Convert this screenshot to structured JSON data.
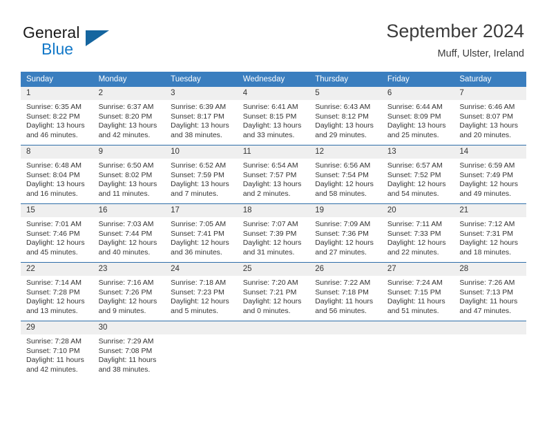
{
  "brand": {
    "name_part1": "General",
    "name_part2": "Blue",
    "accent_color": "#1278c8",
    "triangle_color": "#15659f"
  },
  "header": {
    "title": "September 2024",
    "location": "Muff, Ulster, Ireland"
  },
  "calendar": {
    "header_bg": "#3a7ebf",
    "header_text_color": "#ffffff",
    "daynum_bg": "#efefef",
    "row_divider_color": "#2c6ca8",
    "weekdays": [
      "Sunday",
      "Monday",
      "Tuesday",
      "Wednesday",
      "Thursday",
      "Friday",
      "Saturday"
    ],
    "weeks": [
      [
        {
          "day": "1",
          "sunrise": "Sunrise: 6:35 AM",
          "sunset": "Sunset: 8:22 PM",
          "daylight_line1": "Daylight: 13 hours",
          "daylight_line2": "and 46 minutes."
        },
        {
          "day": "2",
          "sunrise": "Sunrise: 6:37 AM",
          "sunset": "Sunset: 8:20 PM",
          "daylight_line1": "Daylight: 13 hours",
          "daylight_line2": "and 42 minutes."
        },
        {
          "day": "3",
          "sunrise": "Sunrise: 6:39 AM",
          "sunset": "Sunset: 8:17 PM",
          "daylight_line1": "Daylight: 13 hours",
          "daylight_line2": "and 38 minutes."
        },
        {
          "day": "4",
          "sunrise": "Sunrise: 6:41 AM",
          "sunset": "Sunset: 8:15 PM",
          "daylight_line1": "Daylight: 13 hours",
          "daylight_line2": "and 33 minutes."
        },
        {
          "day": "5",
          "sunrise": "Sunrise: 6:43 AM",
          "sunset": "Sunset: 8:12 PM",
          "daylight_line1": "Daylight: 13 hours",
          "daylight_line2": "and 29 minutes."
        },
        {
          "day": "6",
          "sunrise": "Sunrise: 6:44 AM",
          "sunset": "Sunset: 8:09 PM",
          "daylight_line1": "Daylight: 13 hours",
          "daylight_line2": "and 25 minutes."
        },
        {
          "day": "7",
          "sunrise": "Sunrise: 6:46 AM",
          "sunset": "Sunset: 8:07 PM",
          "daylight_line1": "Daylight: 13 hours",
          "daylight_line2": "and 20 minutes."
        }
      ],
      [
        {
          "day": "8",
          "sunrise": "Sunrise: 6:48 AM",
          "sunset": "Sunset: 8:04 PM",
          "daylight_line1": "Daylight: 13 hours",
          "daylight_line2": "and 16 minutes."
        },
        {
          "day": "9",
          "sunrise": "Sunrise: 6:50 AM",
          "sunset": "Sunset: 8:02 PM",
          "daylight_line1": "Daylight: 13 hours",
          "daylight_line2": "and 11 minutes."
        },
        {
          "day": "10",
          "sunrise": "Sunrise: 6:52 AM",
          "sunset": "Sunset: 7:59 PM",
          "daylight_line1": "Daylight: 13 hours",
          "daylight_line2": "and 7 minutes."
        },
        {
          "day": "11",
          "sunrise": "Sunrise: 6:54 AM",
          "sunset": "Sunset: 7:57 PM",
          "daylight_line1": "Daylight: 13 hours",
          "daylight_line2": "and 2 minutes."
        },
        {
          "day": "12",
          "sunrise": "Sunrise: 6:56 AM",
          "sunset": "Sunset: 7:54 PM",
          "daylight_line1": "Daylight: 12 hours",
          "daylight_line2": "and 58 minutes."
        },
        {
          "day": "13",
          "sunrise": "Sunrise: 6:57 AM",
          "sunset": "Sunset: 7:52 PM",
          "daylight_line1": "Daylight: 12 hours",
          "daylight_line2": "and 54 minutes."
        },
        {
          "day": "14",
          "sunrise": "Sunrise: 6:59 AM",
          "sunset": "Sunset: 7:49 PM",
          "daylight_line1": "Daylight: 12 hours",
          "daylight_line2": "and 49 minutes."
        }
      ],
      [
        {
          "day": "15",
          "sunrise": "Sunrise: 7:01 AM",
          "sunset": "Sunset: 7:46 PM",
          "daylight_line1": "Daylight: 12 hours",
          "daylight_line2": "and 45 minutes."
        },
        {
          "day": "16",
          "sunrise": "Sunrise: 7:03 AM",
          "sunset": "Sunset: 7:44 PM",
          "daylight_line1": "Daylight: 12 hours",
          "daylight_line2": "and 40 minutes."
        },
        {
          "day": "17",
          "sunrise": "Sunrise: 7:05 AM",
          "sunset": "Sunset: 7:41 PM",
          "daylight_line1": "Daylight: 12 hours",
          "daylight_line2": "and 36 minutes."
        },
        {
          "day": "18",
          "sunrise": "Sunrise: 7:07 AM",
          "sunset": "Sunset: 7:39 PM",
          "daylight_line1": "Daylight: 12 hours",
          "daylight_line2": "and 31 minutes."
        },
        {
          "day": "19",
          "sunrise": "Sunrise: 7:09 AM",
          "sunset": "Sunset: 7:36 PM",
          "daylight_line1": "Daylight: 12 hours",
          "daylight_line2": "and 27 minutes."
        },
        {
          "day": "20",
          "sunrise": "Sunrise: 7:11 AM",
          "sunset": "Sunset: 7:33 PM",
          "daylight_line1": "Daylight: 12 hours",
          "daylight_line2": "and 22 minutes."
        },
        {
          "day": "21",
          "sunrise": "Sunrise: 7:12 AM",
          "sunset": "Sunset: 7:31 PM",
          "daylight_line1": "Daylight: 12 hours",
          "daylight_line2": "and 18 minutes."
        }
      ],
      [
        {
          "day": "22",
          "sunrise": "Sunrise: 7:14 AM",
          "sunset": "Sunset: 7:28 PM",
          "daylight_line1": "Daylight: 12 hours",
          "daylight_line2": "and 13 minutes."
        },
        {
          "day": "23",
          "sunrise": "Sunrise: 7:16 AM",
          "sunset": "Sunset: 7:26 PM",
          "daylight_line1": "Daylight: 12 hours",
          "daylight_line2": "and 9 minutes."
        },
        {
          "day": "24",
          "sunrise": "Sunrise: 7:18 AM",
          "sunset": "Sunset: 7:23 PM",
          "daylight_line1": "Daylight: 12 hours",
          "daylight_line2": "and 5 minutes."
        },
        {
          "day": "25",
          "sunrise": "Sunrise: 7:20 AM",
          "sunset": "Sunset: 7:21 PM",
          "daylight_line1": "Daylight: 12 hours",
          "daylight_line2": "and 0 minutes."
        },
        {
          "day": "26",
          "sunrise": "Sunrise: 7:22 AM",
          "sunset": "Sunset: 7:18 PM",
          "daylight_line1": "Daylight: 11 hours",
          "daylight_line2": "and 56 minutes."
        },
        {
          "day": "27",
          "sunrise": "Sunrise: 7:24 AM",
          "sunset": "Sunset: 7:15 PM",
          "daylight_line1": "Daylight: 11 hours",
          "daylight_line2": "and 51 minutes."
        },
        {
          "day": "28",
          "sunrise": "Sunrise: 7:26 AM",
          "sunset": "Sunset: 7:13 PM",
          "daylight_line1": "Daylight: 11 hours",
          "daylight_line2": "and 47 minutes."
        }
      ],
      [
        {
          "day": "29",
          "sunrise": "Sunrise: 7:28 AM",
          "sunset": "Sunset: 7:10 PM",
          "daylight_line1": "Daylight: 11 hours",
          "daylight_line2": "and 42 minutes."
        },
        {
          "day": "30",
          "sunrise": "Sunrise: 7:29 AM",
          "sunset": "Sunset: 7:08 PM",
          "daylight_line1": "Daylight: 11 hours",
          "daylight_line2": "and 38 minutes."
        },
        {
          "day": "",
          "sunrise": "",
          "sunset": "",
          "daylight_line1": "",
          "daylight_line2": ""
        },
        {
          "day": "",
          "sunrise": "",
          "sunset": "",
          "daylight_line1": "",
          "daylight_line2": ""
        },
        {
          "day": "",
          "sunrise": "",
          "sunset": "",
          "daylight_line1": "",
          "daylight_line2": ""
        },
        {
          "day": "",
          "sunrise": "",
          "sunset": "",
          "daylight_line1": "",
          "daylight_line2": ""
        },
        {
          "day": "",
          "sunrise": "",
          "sunset": "",
          "daylight_line1": "",
          "daylight_line2": ""
        }
      ]
    ]
  }
}
